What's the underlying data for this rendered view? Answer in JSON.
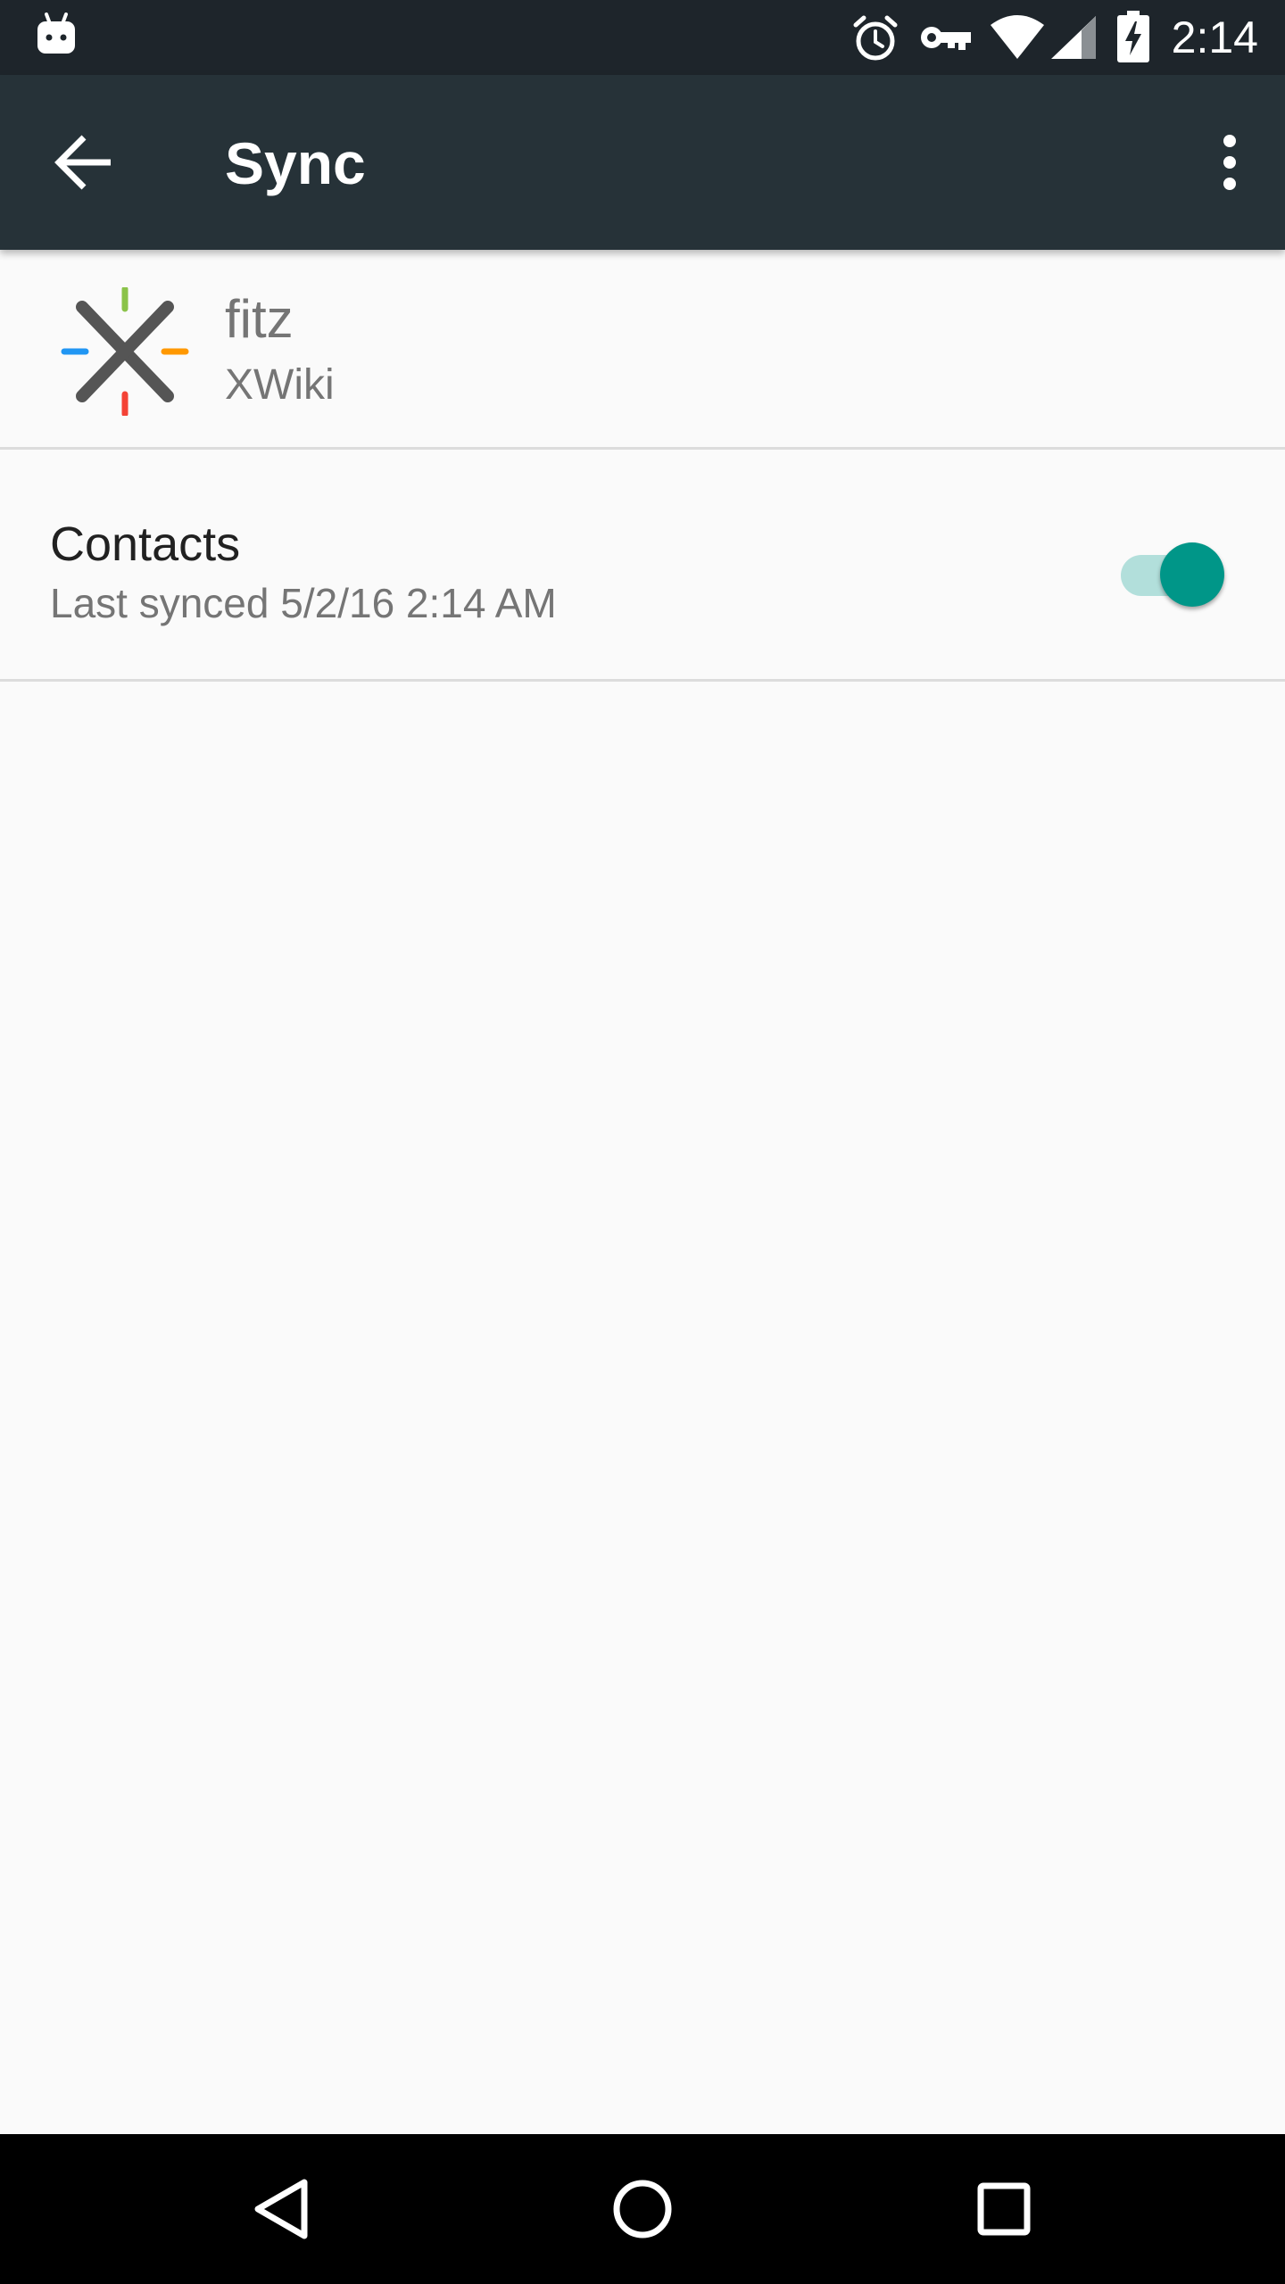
{
  "status_bar": {
    "time": "2:14",
    "icons": [
      "android-debug-icon",
      "alarm-icon",
      "vpn-key-icon",
      "wifi-icon",
      "signal-icon",
      "battery-charging-icon"
    ]
  },
  "app_bar": {
    "title": "Sync",
    "back_icon": "arrow-back-icon",
    "more_icon": "more-vert-icon"
  },
  "account": {
    "name": "fitz",
    "type": "XWiki",
    "icon": "xwiki-logo-icon"
  },
  "sync_items": [
    {
      "title": "Contacts",
      "summary": "Last synced 5/2/16 2:14 AM",
      "enabled": true
    }
  ],
  "nav_bar": {
    "icons": [
      "nav-back-icon",
      "nav-home-icon",
      "nav-recents-icon"
    ]
  },
  "colors": {
    "status_bar": "#1e252b",
    "app_bar": "#263238",
    "accent": "#009688",
    "accent_track": "#b2dfdb",
    "background": "#fafafa"
  }
}
